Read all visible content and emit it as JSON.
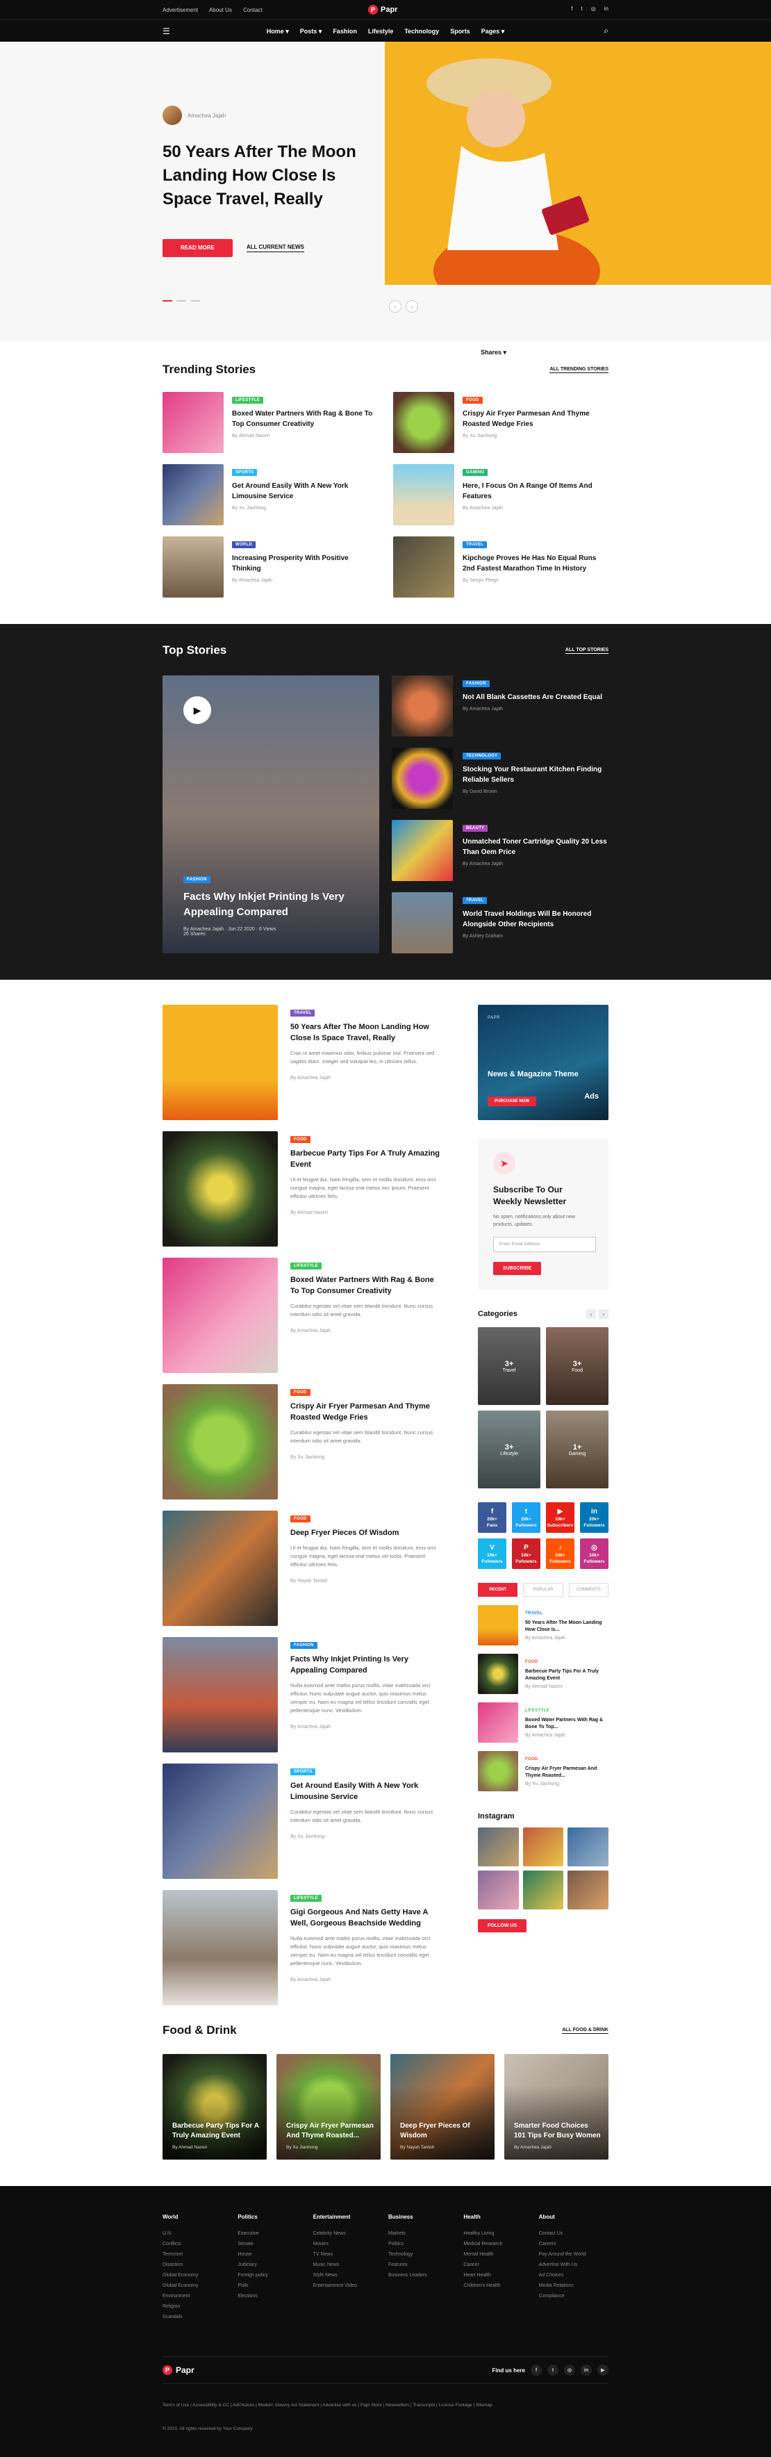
{
  "topbar": {
    "links": [
      "Advertisement",
      "About Us",
      "Contact"
    ],
    "logo": "Papr",
    "social": [
      "f",
      "t",
      "◎",
      "in"
    ]
  },
  "nav": {
    "items": [
      "Home ▾",
      "Posts ▾",
      "Fashion",
      "Lifestyle",
      "Technology",
      "Sports",
      "Pages ▾"
    ]
  },
  "hero": {
    "author": "Amachea Jajah",
    "title": "50 Years After The Moon Landing How Close Is Space Travel, Really",
    "read_more": "READ MORE",
    "all_posts": "ALL CURRENT NEWS",
    "shares": "Shares ▾"
  },
  "trending": {
    "title": "Trending Stories",
    "all": "ALL TRENDING STORIES",
    "items": [
      {
        "badge": "LIFESTYLE",
        "color": "#3ec55b",
        "title": "Boxed Water Partners With Rag & Bone To Top Consumer Creativity",
        "by": "By Ahmad Nazeri"
      },
      {
        "badge": "FOOD",
        "color": "#f4511e",
        "title": "Crispy Air Fryer Parmesan And Thyme Roasted Wedge Fries",
        "by": "By Xu Jianhong"
      },
      {
        "badge": "SPORTS",
        "color": "#29b6f6",
        "title": "Get Around Easily With A New York Limousine Service",
        "by": "By Xu Jianhong"
      },
      {
        "badge": "GAMING",
        "color": "#2ab673",
        "title": "Here, I Focus On A Range Of Items And Features",
        "by": "By Amachea Jajah"
      },
      {
        "badge": "WORLD",
        "color": "#3f51b5",
        "title": "Increasing Prosperity With Positive Thinking",
        "by": "By Amachea Jajah"
      },
      {
        "badge": "TRAVEL",
        "color": "#1e88e5",
        "title": "Kipchoge Proves He Has No Equal Runs 2nd Fastest Marathon Time In History",
        "by": "By Sergio Pliego"
      }
    ]
  },
  "topstories": {
    "title": "Top Stories",
    "all": "ALL TOP STORIES",
    "big": {
      "badge": "FASHION",
      "title": "Facts Why Inkjet Printing Is Very Appealing Compared",
      "meta": "By Amachea Jajah   ·   Jun 22 2020   ·   6 Views",
      "shares": "26 Shares"
    },
    "items": [
      {
        "badge": "FASHION",
        "color": "#1e88e5",
        "title": "Not All Blank Cassettes Are Created Equal",
        "by": "By Amachea Jajah"
      },
      {
        "badge": "TECHNOLOGY",
        "color": "#1e88e5",
        "title": "Stocking Your Restaurant Kitchen Finding Reliable Sellers",
        "by": "By David Brown"
      },
      {
        "badge": "BEAUTY",
        "color": "#ab47bc",
        "title": "Unmatched Toner Cartridge Quality 20 Less Than Oem Price",
        "by": "By Amachea Jajah"
      },
      {
        "badge": "TRAVEL",
        "color": "#1e88e5",
        "title": "World Travel Holdings Will Be Honored Alongside Other Recipients",
        "by": "By Ashley Graham"
      }
    ]
  },
  "main": {
    "items": [
      {
        "badge": "TRAVEL",
        "color": "#7e57c2",
        "title": "50 Years After The Moon Landing How Close Is Space Travel, Really",
        "text": "Cras ut amet maximus odio, finibus pulvinar nisl. Praesent sed sagittis diam. Integer sed volutpat leo, in ultricies tellus.",
        "by": "By Amachea Jajah"
      },
      {
        "badge": "FOOD",
        "color": "#f4511e",
        "title": "Barbecue Party Tips For A Truly Amazing Event",
        "text": "Ut et feugiat dui. Nam fringilla, sem et mollis tincidunt, eros orci congue magna, eget lacinia erat metus nec ipsum. Praesent efficitur ultricies felis.",
        "by": "By Ahmad Nazeri"
      },
      {
        "badge": "LIFESTYLE",
        "color": "#3ec55b",
        "title": "Boxed Water Partners With Rag & Bone To Top Consumer Creativity",
        "text": "Curabitur egestas vel vitae sem blandit tincidunt. Nunc cursus interdum odio sit amet gravida.",
        "by": "By Amachea Jajah"
      },
      {
        "badge": "FOOD",
        "color": "#f4511e",
        "title": "Crispy Air Fryer Parmesan And Thyme Roasted Wedge Fries",
        "text": "Curabitur egestas vel vitae sem blandit tincidunt. Nunc cursus interdum odio sit amet gravida.",
        "by": "By Xu Jianhong"
      },
      {
        "badge": "FOOD",
        "color": "#f4511e",
        "title": "Deep Fryer Pieces Of Wisdom",
        "text": "Ut et feugiat dui. Nam fringilla, sem et mollis tincidunt, eros orci congue magna, eget lacinia erat metus vel tortor. Praesent efficitur ultricies felis.",
        "by": "By Nayah Tantoh"
      },
      {
        "badge": "FASHION",
        "color": "#1e88e5",
        "title": "Facts Why Inkjet Printing Is Very Appealing Compared",
        "text": "Nulla euismod ante mattis purus mollis, vitae malesuada orci efficitur. Nunc vulputate augue auctor, quis maximus metus semper eu. Nam eu magna vel tellus tincidunt convallis eget pellentesque nunc. Vestibulum.",
        "by": "By Amachea Jajah"
      },
      {
        "badge": "SPORTS",
        "color": "#29b6f6",
        "title": "Get Around Easily With A New York Limousine Service",
        "text": "Curabitur egestas vel vitae sem blandit tincidunt. Nunc cursus interdum odio sit amet gravida.",
        "by": "By Xu Jianhong"
      },
      {
        "badge": "LIFESTYLE",
        "color": "#3ec55b",
        "title": "Gigi Gorgeous And Nats Getty Have A Well, Gorgeous Beachside Wedding",
        "text": "Nulla euismod ante mattis purus mollis, vitae malesuada orci efficitur. Nunc vulputate augue auctor, quis maximus metus semper eu. Nam eu magna vel tellus tincidunt convallis eget pellentesque nunc. Vestibulum.",
        "by": "By Amachea Jajah"
      }
    ]
  },
  "sidebar": {
    "ad": {
      "label": "PAPR",
      "title": "News & Magazine Theme",
      "btn": "PURCHASE NOW",
      "ads": "Ads"
    },
    "newsletter": {
      "title": "Subscribe To Our Weekly Newsletter",
      "text": "No spam, notifications only about new products, updates.",
      "placeholder": "Enter Email Address",
      "btn": "SUBSCRIBE"
    },
    "categories": {
      "title": "Categories",
      "items": [
        {
          "n": "3+",
          "l": "Travel"
        },
        {
          "n": "3+",
          "l": "Food"
        },
        {
          "n": "3+",
          "l": "Lifestyle"
        },
        {
          "n": "1+",
          "l": "Gaming"
        }
      ]
    },
    "social": [
      {
        "i": "f",
        "c": "20k+",
        "l": "Fans",
        "bg": "#3b5998"
      },
      {
        "i": "t",
        "c": "20k+",
        "l": "Followers",
        "bg": "#1da1f2"
      },
      {
        "i": "▶",
        "c": "10k+",
        "l": "Subscribers",
        "bg": "#e62117"
      },
      {
        "i": "in",
        "c": "20k+",
        "l": "Followers",
        "bg": "#0077b5"
      },
      {
        "i": "V",
        "c": "10k+",
        "l": "Followers",
        "bg": "#1ab7ea"
      },
      {
        "i": "P",
        "c": "10k+",
        "l": "Followers",
        "bg": "#cb2027"
      },
      {
        "i": "♪",
        "c": "10k+",
        "l": "Followers",
        "bg": "#ff5500"
      },
      {
        "i": "◎",
        "c": "10k+",
        "l": "Followers",
        "bg": "#c13584"
      }
    ],
    "tabs": [
      "RECENT",
      "POPULAR",
      "COMMENTS"
    ],
    "posts": [
      {
        "badge": "TRAVEL",
        "color": "#1e88e5",
        "title": "50 Years After The Moon Landing How Close Is...",
        "by": "By Amachea Jajah"
      },
      {
        "badge": "FOOD",
        "color": "#f4511e",
        "title": "Barbecue Party Tips For A Truly Amazing Event",
        "by": "By Ahmad Nazeri"
      },
      {
        "badge": "LIFESTYLE",
        "color": "#3ec55b",
        "title": "Boxed Water Partners With Rag & Bone To Top...",
        "by": "By Amachea Jajah"
      },
      {
        "badge": "FOOD",
        "color": "#f4511e",
        "title": "Crispy Air Fryer Parmesan And Thyme Roasted...",
        "by": "By Xu Jianhong"
      }
    ],
    "instagram": "Instagram",
    "follow": "FOLLOW US"
  },
  "food": {
    "title": "Food & Drink",
    "all": "ALL FOOD & DRINK",
    "items": [
      {
        "title": "Barbecue Party Tips For A Truly Amazing Event",
        "by": "By Ahmad Nazeri"
      },
      {
        "title": "Crispy Air Fryer Parmesan And Thyme Roasted...",
        "by": "By Xu Jianhong"
      },
      {
        "title": "Deep Fryer Pieces Of Wisdom",
        "by": "By Nayah Tantoh"
      },
      {
        "title": "Smarter Food Choices 101 Tips For Busy Women",
        "by": "By Amachea Jajah"
      }
    ]
  },
  "footer": {
    "cols": [
      {
        "h": "World",
        "items": [
          "U.N.",
          "Conflicts",
          "Terrorism",
          "Disasters",
          "Global Economy",
          "Global Economy",
          "Environment",
          "Religion",
          "Scandals"
        ]
      },
      {
        "h": "Politics",
        "items": [
          "Executive",
          "Senate",
          "House",
          "Judiciary",
          "Foreign policy",
          "Polls",
          "Elections"
        ]
      },
      {
        "h": "Entertainment",
        "items": [
          "Celebrity News",
          "Movies",
          "TV News",
          "Music News",
          "Style News",
          "Entertainment Video"
        ]
      },
      {
        "h": "Business",
        "items": [
          "Markets",
          "Politics",
          "Technology",
          "Features",
          "Business Leaders"
        ]
      },
      {
        "h": "Health",
        "items": [
          "Healthy Living",
          "Medical Research",
          "Mental Health",
          "Cancer",
          "Heart Health",
          "Children's Health"
        ]
      },
      {
        "h": "About",
        "items": [
          "Contact Us",
          "Careers",
          "Pay Around the World",
          "Advertise With Us",
          "Ad Choices",
          "Media Relations",
          "Compliance"
        ]
      }
    ],
    "logo": "Papr",
    "find": "Find us here",
    "social": [
      "f",
      "t",
      "◎",
      "in",
      "▶"
    ],
    "links": "Terms of Use  |  Accessibility & CC  |  AdChoices  |  Modern Slavery Act Statement  |  Advertise with us  |  Papr Store  |  Newsletters  |  Transcripts  |  License Footage  |  Sitemap",
    "copy": "© 2021. All rights reserved by Your Company"
  }
}
